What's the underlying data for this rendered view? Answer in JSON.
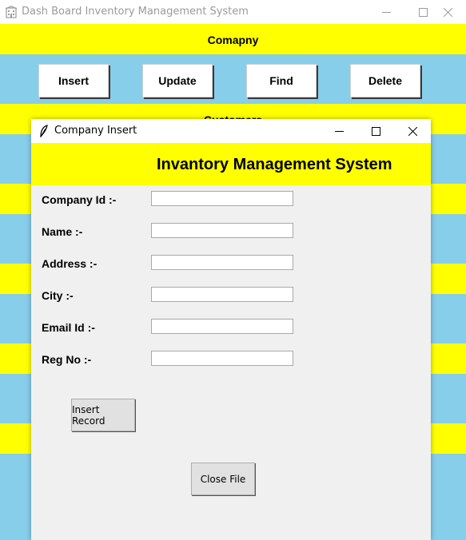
{
  "main_window": {
    "title": "Dash Board Inventory Management System",
    "section_company": "Comapny",
    "section_customers": "Customers",
    "buttons": {
      "insert": "Insert",
      "update": "Update",
      "find": "Find",
      "delete": "Delete"
    }
  },
  "dialog": {
    "title": "Company Insert",
    "header": "Invantory Management System",
    "fields": [
      {
        "label": "Company Id :-",
        "value": ""
      },
      {
        "label": "Name :-",
        "value": ""
      },
      {
        "label": "Address :-",
        "value": ""
      },
      {
        "label": "City :-",
        "value": ""
      },
      {
        "label": "Email Id :-",
        "value": ""
      },
      {
        "label": "Reg No :-",
        "value": ""
      }
    ],
    "insert_button": "Insert Record",
    "close_button": "Close File"
  },
  "colors": {
    "band": "#ffff00",
    "background": "#87ceeb"
  },
  "icons": {
    "app": "building-icon",
    "dialog": "feather-icon"
  }
}
